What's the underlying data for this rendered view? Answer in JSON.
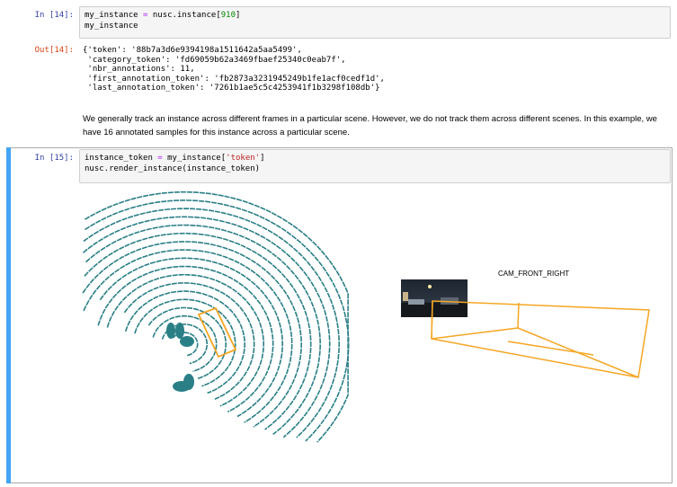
{
  "cell14": {
    "in_prompt": "In [14]:",
    "code_line1_var": "my_instance",
    "code_line1_op": "=",
    "code_line1_call": "nusc.instance[",
    "code_line1_num": "910",
    "code_line1_end": "]",
    "code_line2": "my_instance",
    "out_prompt": "Out[14]:",
    "output_lines": [
      "{'token': '88b7a3d6e9394198a1511642a5aa5499',",
      " 'category_token': 'fd69059b62a3469fbaef25340c0eab7f',",
      " 'nbr_annotations': 11,",
      " 'first_annotation_token': 'fb2873a3231945249b1fe1acf0cedf1d',",
      " 'last_annotation_token': '7261b1ae5c5c4253941f1b3298f108db'}"
    ]
  },
  "markdown": {
    "text": "We generally track an instance across different frames in a particular scene. However, we do not track them across different scenes. In this example, we have 16 annotated samples for this instance across a particular scene."
  },
  "cell15": {
    "in_prompt": "In [15]:",
    "code_line1_var": "instance_token",
    "code_line1_op": "=",
    "code_line1_mid": "my_instance[",
    "code_line1_str": "'token'",
    "code_line1_end": "]",
    "code_line2": "nusc.render_instance(instance_token)"
  },
  "render": {
    "camera_title": "CAM_FRONT_RIGHT",
    "lidar_color": "#2a7f86",
    "box_color": "#f5a623"
  }
}
